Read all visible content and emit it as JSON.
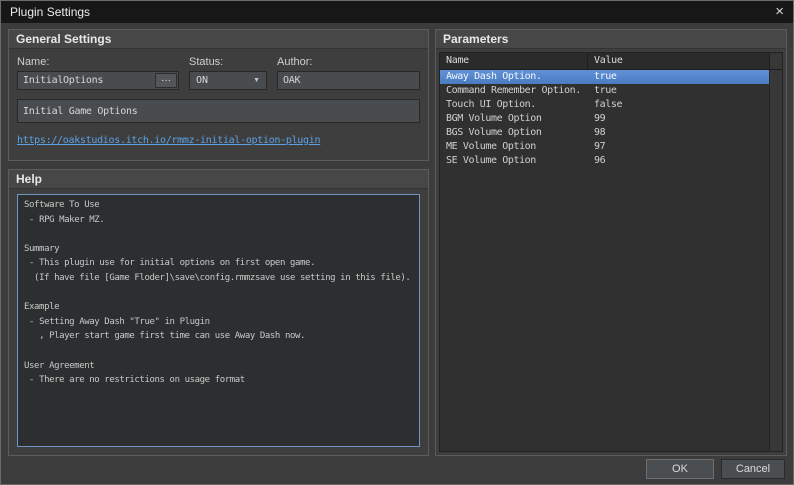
{
  "window": {
    "title": "Plugin Settings"
  },
  "icons": {
    "close": "×",
    "browse": "···",
    "dropdown_arrow": "▼"
  },
  "general": {
    "title": "General Settings",
    "name_label": "Name:",
    "name_value": "InitialOptions",
    "status_label": "Status:",
    "status_value": "ON",
    "author_label": "Author:",
    "author_value": "OAK",
    "description": "Initial Game Options",
    "link": "https://oakstudios.itch.io/rmmz-initial-option-plugin"
  },
  "help": {
    "title": "Help",
    "text": "Software To Use\n - RPG Maker MZ.\n\nSummary\n - This plugin use for initial options on first open game.\n  (If have file [Game Floder]\\save\\config.rmmzsave use setting in this file).\n\nExample\n - Setting Away Dash \"True\" in Plugin\n   , Player start game first time can use Away Dash now.\n\nUser Agreement\n - There are no restrictions on usage format"
  },
  "parameters": {
    "title": "Parameters",
    "columns": [
      "Name",
      "Value"
    ],
    "rows": [
      {
        "name": "Away Dash Option.",
        "value": "true",
        "selected": true
      },
      {
        "name": "Command Remember Option.",
        "value": "true",
        "selected": false
      },
      {
        "name": "Touch UI Option.",
        "value": "false",
        "selected": false
      },
      {
        "name": "BGM Volume Option",
        "value": "99",
        "selected": false
      },
      {
        "name": "BGS Volume Option",
        "value": "98",
        "selected": false
      },
      {
        "name": "ME Volume Option",
        "value": "97",
        "selected": false
      },
      {
        "name": "SE Volume Option",
        "value": "96",
        "selected": false
      }
    ]
  },
  "footer": {
    "ok_label": "OK",
    "cancel_label": "Cancel"
  },
  "colors": {
    "selection_blue": "#4a7cc2",
    "link_blue": "#5aa2e4",
    "help_border_blue": "#6f96c0"
  }
}
